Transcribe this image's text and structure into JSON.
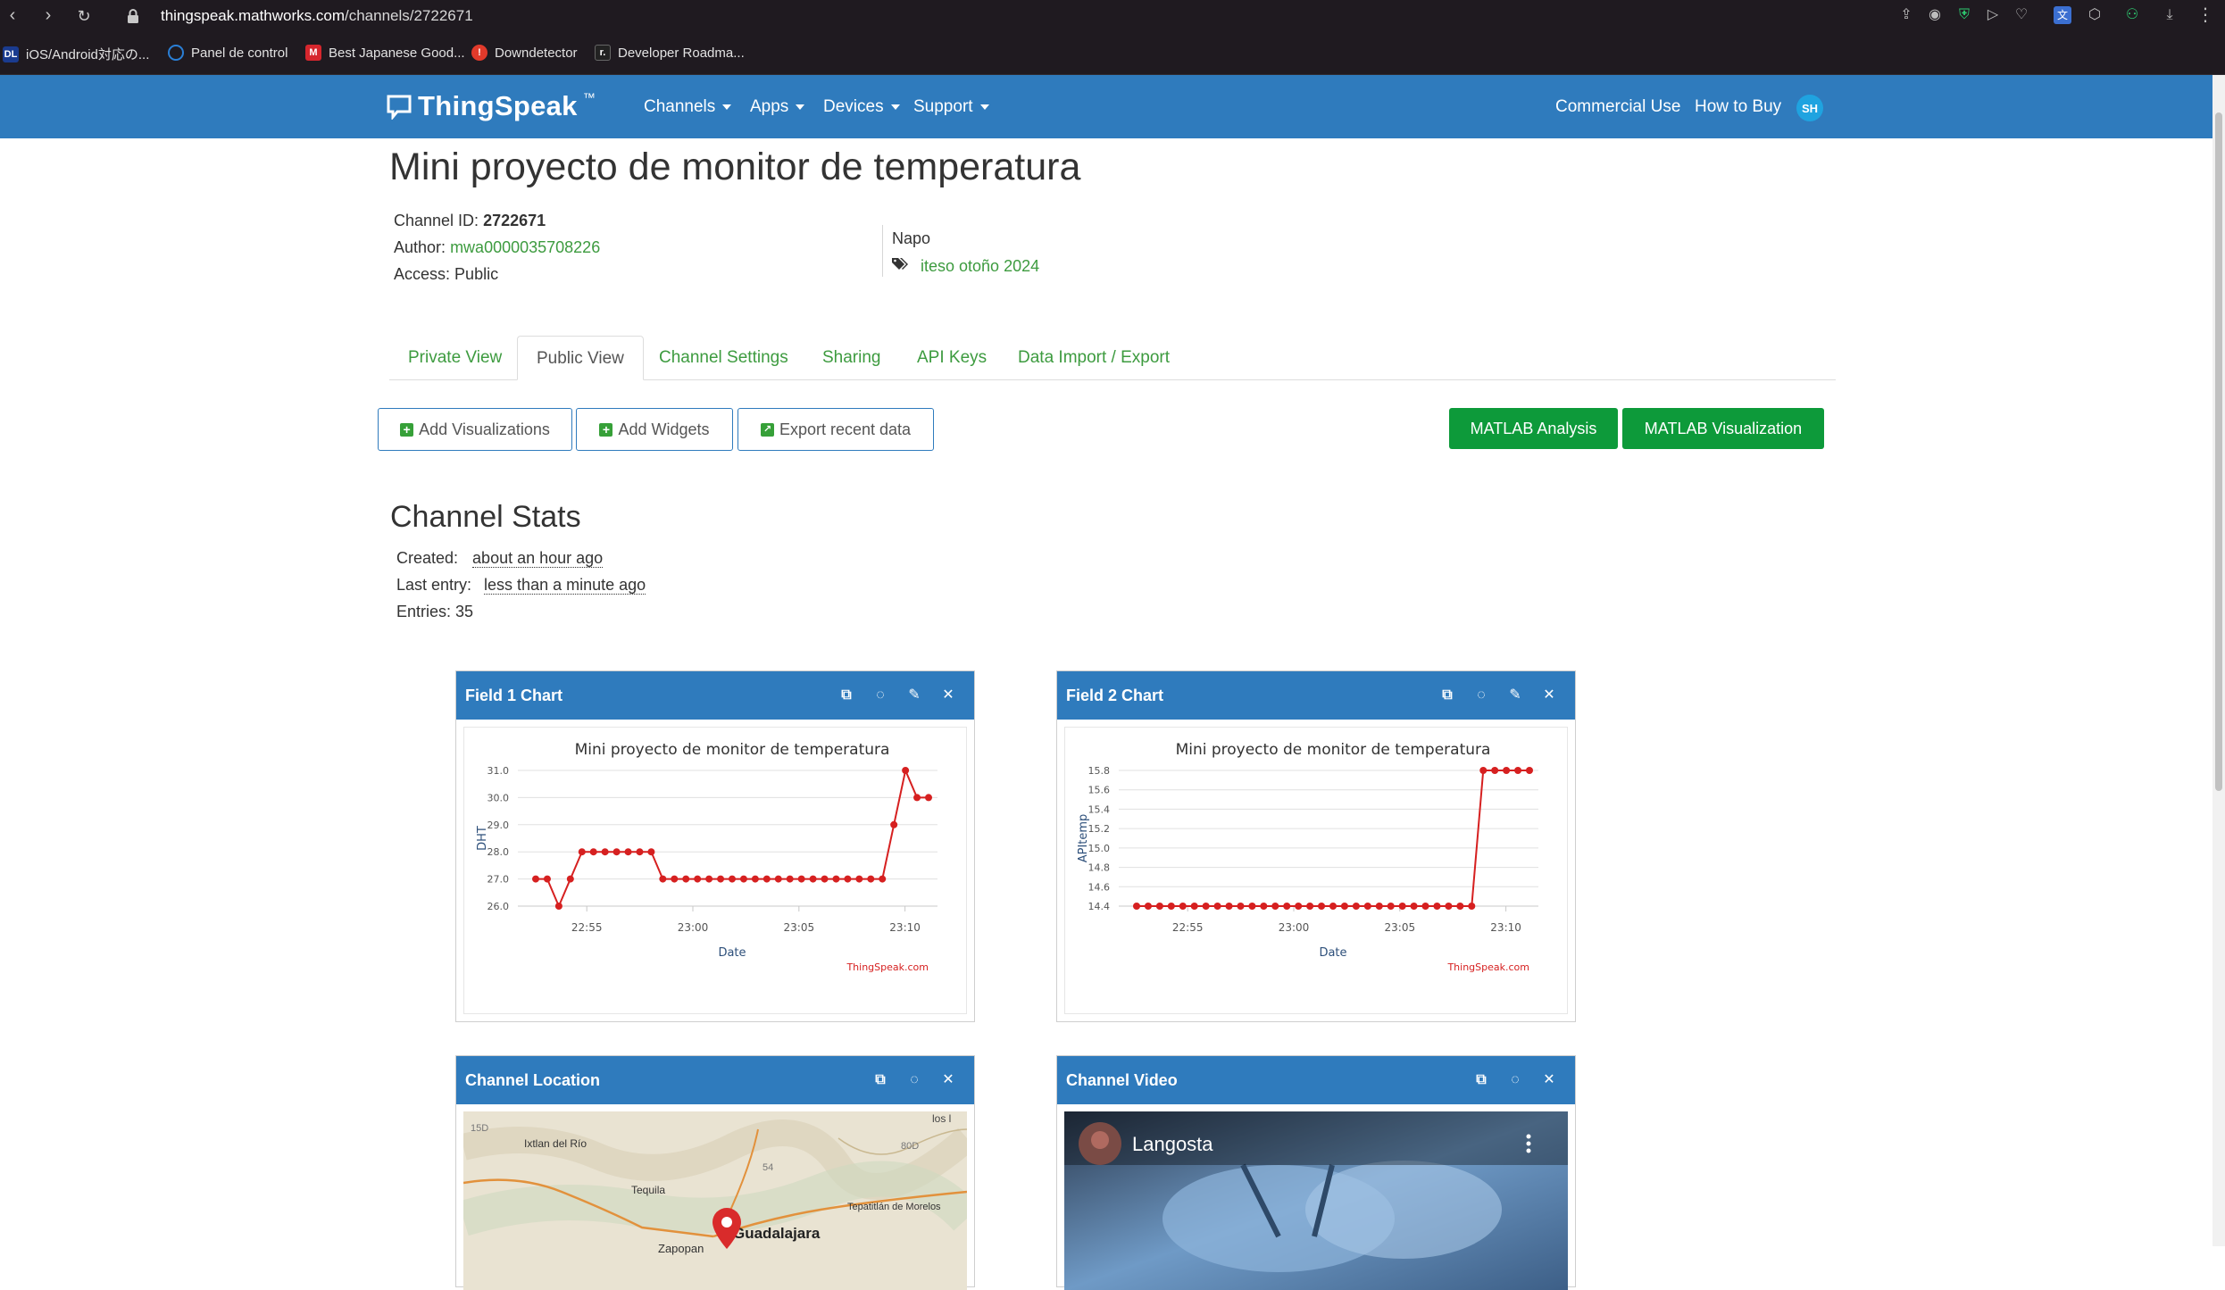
{
  "browser": {
    "url_host": "thingspeak.mathworks.com",
    "url_path": "/channels/2722671",
    "bookmarks": [
      {
        "icon": "DL",
        "label": "iOS/Android対応の...",
        "color": "#1a3b8f"
      },
      {
        "icon": "◯",
        "label": "Panel de control",
        "color": "#2a7fd6"
      },
      {
        "icon": "M",
        "label": "Best Japanese Good...",
        "color": "#d6262d"
      },
      {
        "icon": "!",
        "label": "Downdetector",
        "color": "#e23a2b"
      },
      {
        "icon": "r.",
        "label": "Developer Roadma...",
        "color": "#222222"
      }
    ]
  },
  "header": {
    "logo": "ThingSpeak",
    "logo_tm": "™",
    "nav": [
      "Channels",
      "Apps",
      "Devices",
      "Support"
    ],
    "right_links": [
      "Commercial Use",
      "How to Buy"
    ],
    "avatar": "SH"
  },
  "channel": {
    "title": "Mini proyecto de monitor de temperatura",
    "id_label": "Channel ID:",
    "id": "2722671",
    "author_label": "Author:",
    "author": "mwa0000035708226",
    "access_label": "Access:",
    "access": "Public",
    "description": "Napo",
    "tag": "iteso otoño 2024"
  },
  "tabs": [
    "Private View",
    "Public View",
    "Channel Settings",
    "Sharing",
    "API Keys",
    "Data Import / Export"
  ],
  "active_tab": "Public View",
  "buttons": {
    "add_visualizations": "Add Visualizations",
    "add_widgets": "Add Widgets",
    "export_recent": "Export recent data",
    "matlab_analysis": "MATLAB Analysis",
    "matlab_visualization": "MATLAB Visualization"
  },
  "stats": {
    "title": "Channel Stats",
    "created_label": "Created:",
    "created": "about an hour ago",
    "last_entry_label": "Last entry:",
    "last_entry": "less than a minute ago",
    "entries_label": "Entries:",
    "entries": "35"
  },
  "widgets": {
    "field1": {
      "title": "Field 1 Chart"
    },
    "field2": {
      "title": "Field 2 Chart"
    },
    "location": {
      "title": "Channel Location"
    },
    "video": {
      "title": "Channel Video",
      "video_title": "Langosta"
    }
  },
  "map": {
    "labels": [
      "Ixtlan del Río",
      "Tequila",
      "Guadalajara",
      "Tepatitlán de Morelos",
      "Zapopan",
      "15D",
      "80D",
      "54",
      "los l"
    ]
  },
  "chart_data": [
    {
      "type": "line",
      "title": "Mini proyecto de monitor de temperatura",
      "xlabel": "Date",
      "ylabel": "DHT",
      "credit": "ThingSpeak.com",
      "ylim": [
        26.0,
        31.0
      ],
      "yticks": [
        "31.0",
        "30.0",
        "29.0",
        "28.0",
        "27.0",
        "26.0"
      ],
      "xticks": [
        "22:55",
        "23:00",
        "23:05",
        "23:10"
      ],
      "color": "#d62020",
      "series": [
        {
          "values": [
            27,
            27,
            26,
            27,
            28,
            28,
            28,
            28,
            28,
            28,
            28,
            27,
            27,
            27,
            27,
            27,
            27,
            27,
            27,
            27,
            27,
            27,
            27,
            27,
            27,
            27,
            27,
            27,
            27,
            27,
            27,
            29,
            31,
            30,
            30
          ]
        }
      ]
    },
    {
      "type": "line",
      "title": "Mini proyecto de monitor de temperatura",
      "xlabel": "Date",
      "ylabel": "APItemp",
      "credit": "ThingSpeak.com",
      "ylim": [
        14.4,
        15.8
      ],
      "yticks": [
        "15.8",
        "15.6",
        "15.4",
        "15.2",
        "15.0",
        "14.8",
        "14.6",
        "14.4"
      ],
      "xticks": [
        "22:55",
        "23:00",
        "23:05",
        "23:10"
      ],
      "color": "#d62020",
      "series": [
        {
          "values": [
            14.4,
            14.4,
            14.4,
            14.4,
            14.4,
            14.4,
            14.4,
            14.4,
            14.4,
            14.4,
            14.4,
            14.4,
            14.4,
            14.4,
            14.4,
            14.4,
            14.4,
            14.4,
            14.4,
            14.4,
            14.4,
            14.4,
            14.4,
            14.4,
            14.4,
            14.4,
            14.4,
            14.4,
            14.4,
            14.4,
            15.8,
            15.8,
            15.8,
            15.8,
            15.8
          ]
        }
      ]
    }
  ]
}
